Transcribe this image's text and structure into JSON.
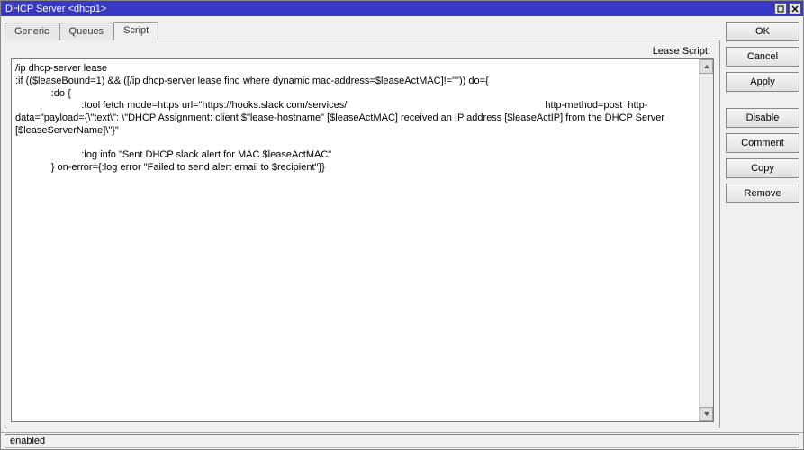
{
  "title": "DHCP Server <dhcp1>",
  "tabs": [
    {
      "label": "Generic"
    },
    {
      "label": "Queues"
    },
    {
      "label": "Script"
    }
  ],
  "active_tab_index": 2,
  "script_panel": {
    "label": "Lease Script:",
    "content": "/ip dhcp-server lease\n:if (($leaseBound=1) && ([/ip dhcp-server lease find where dynamic mac-address=$leaseActMAC]!=\"\")) do={\n             :do {\n                        :tool fetch mode=https url=\"https://hooks.slack.com/services/                                                                        http-method=post  http-data=\"payload={\\\"text\\\": \\\"DHCP Assignment: client $\"lease-hostname\" [$leaseActMAC] received an IP address [$leaseActIP] from the DHCP Server [$leaseServerName]\\\"}\"\n\n                        :log info \"Sent DHCP slack alert for MAC $leaseActMAC\"\n             } on-error={:log error \"Failed to send alert email to $recipient\"}}"
  },
  "buttons": {
    "ok": "OK",
    "cancel": "Cancel",
    "apply": "Apply",
    "disable": "Disable",
    "comment": "Comment",
    "copy": "Copy",
    "remove": "Remove"
  },
  "status": "enabled"
}
